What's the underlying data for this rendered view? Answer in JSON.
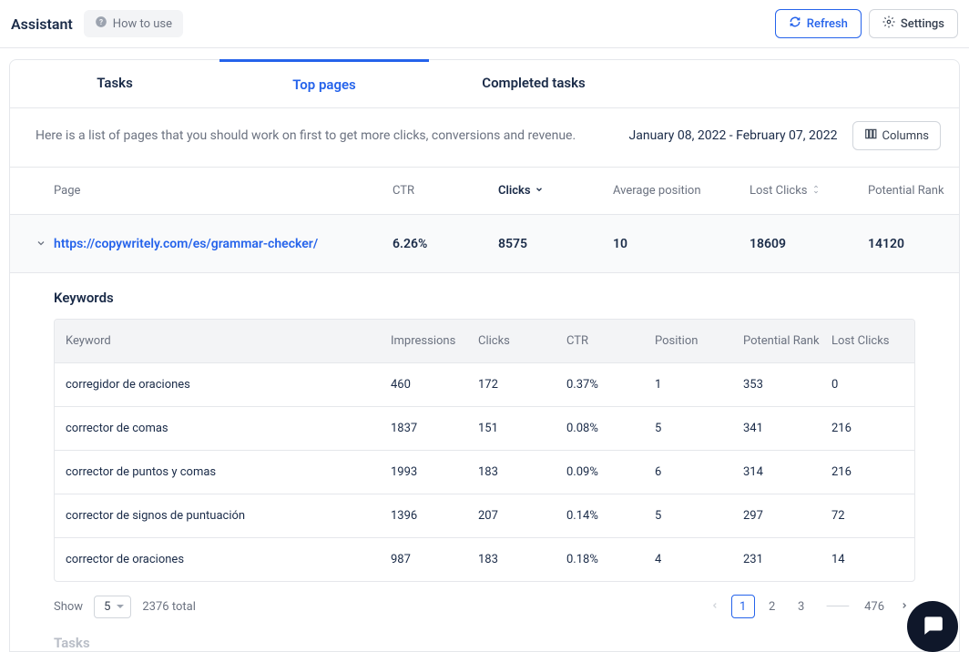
{
  "app": {
    "title": "Assistant"
  },
  "topbar": {
    "howto_label": "How to use",
    "refresh_label": "Refresh",
    "settings_label": "Settings"
  },
  "tabs": {
    "tasks": "Tasks",
    "top_pages": "Top pages",
    "completed": "Completed tasks"
  },
  "subheader": {
    "description": "Here is a list of pages that you should work on first to get more clicks, conversions and revenue.",
    "date_range": "January 08, 2022 - February 07, 2022",
    "columns_label": "Columns"
  },
  "columns": {
    "page": "Page",
    "ctr": "CTR",
    "clicks": "Clicks",
    "avg_pos": "Average position",
    "lost_clicks": "Lost Clicks",
    "potential_rank": "Potential Rank"
  },
  "page_row": {
    "url": "https://copywritely.com/es/grammar-checker/",
    "ctr": "6.26%",
    "clicks": "8575",
    "avg_pos": "10",
    "lost_clicks": "18609",
    "potential_rank": "14120"
  },
  "keywords": {
    "title": "Keywords",
    "head": {
      "keyword": "Keyword",
      "impressions": "Impressions",
      "clicks": "Clicks",
      "ctr": "CTR",
      "position": "Position",
      "potential_rank": "Potential Rank",
      "lost_clicks": "Lost Clicks"
    },
    "rows": [
      {
        "keyword": "corregidor de oraciones",
        "impressions": "460",
        "clicks": "172",
        "ctr": "0.37%",
        "position": "1",
        "potential_rank": "353",
        "lost_clicks": "0"
      },
      {
        "keyword": "corrector de comas",
        "impressions": "1837",
        "clicks": "151",
        "ctr": "0.08%",
        "position": "5",
        "potential_rank": "341",
        "lost_clicks": "216"
      },
      {
        "keyword": "corrector de puntos y comas",
        "impressions": "1993",
        "clicks": "183",
        "ctr": "0.09%",
        "position": "6",
        "potential_rank": "314",
        "lost_clicks": "216"
      },
      {
        "keyword": "corrector de signos de puntuación",
        "impressions": "1396",
        "clicks": "207",
        "ctr": "0.14%",
        "position": "5",
        "potential_rank": "297",
        "lost_clicks": "72"
      },
      {
        "keyword": "corrector de oraciones",
        "impressions": "987",
        "clicks": "183",
        "ctr": "0.18%",
        "position": "4",
        "potential_rank": "231",
        "lost_clicks": "14"
      }
    ]
  },
  "footer": {
    "show_label": "Show",
    "show_value": "5",
    "total": "2376 total",
    "pages": {
      "p1": "1",
      "p2": "2",
      "p3": "3",
      "last": "476"
    }
  },
  "tasks_section": {
    "title": "Tasks"
  }
}
